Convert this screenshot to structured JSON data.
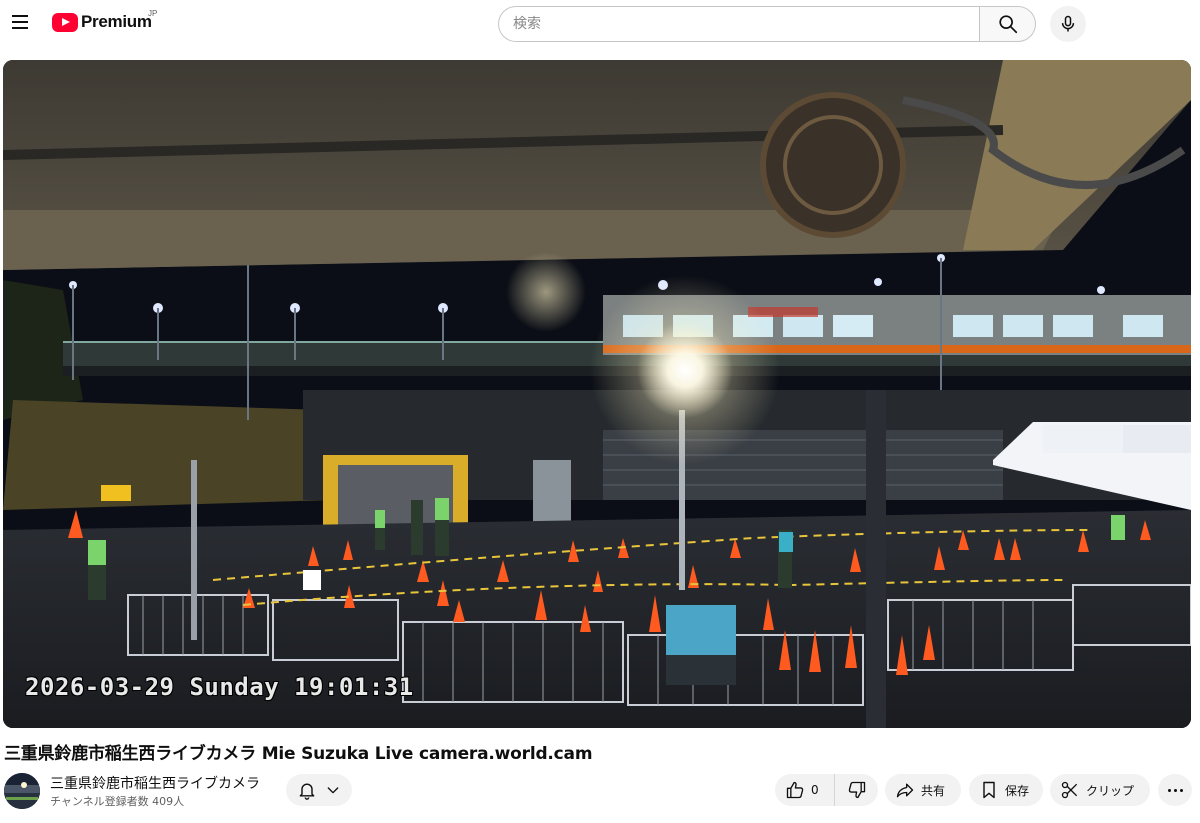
{
  "header": {
    "brand": "Premium",
    "region": "JP",
    "search_placeholder": "検索",
    "icons": [
      "menu-icon",
      "youtube-logo-icon",
      "search-icon",
      "microphone-icon"
    ]
  },
  "player": {
    "overlay_timestamp": "2026-03-29 Sunday 19:01:31"
  },
  "video": {
    "title": "三重県鈴鹿市稲生西ライブカメラ Mie Suzuka Live camera.world.cam"
  },
  "channel": {
    "name": "三重県鈴鹿市稲生西ライブカメラ",
    "subscribers": "チャンネル登録者数 409人"
  },
  "actions": {
    "like_count": "0",
    "share_label": "共有",
    "save_label": "保存",
    "clip_label": "クリップ"
  },
  "colors": {
    "brand_red": "#ff0033",
    "button_bg": "#f2f2f2",
    "text_primary": "#0f0f0f",
    "text_secondary": "#606060"
  }
}
